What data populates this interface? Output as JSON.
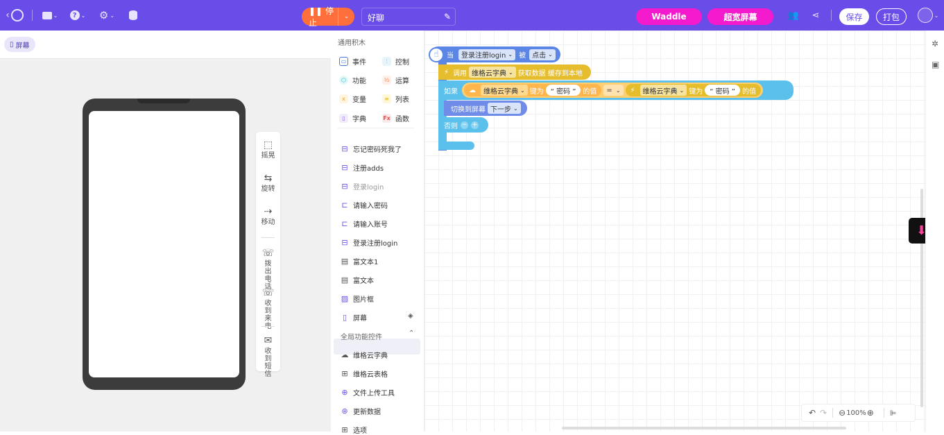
{
  "toolbar": {
    "back": "‹",
    "stop_label": "停止",
    "project_name": "好聊",
    "waddle_label": "Waddle",
    "wide_screen_label": "超宽屏幕",
    "save_label": "保存",
    "pack_label": "打包"
  },
  "screen_tab": {
    "label": "屏幕"
  },
  "device_tools": [
    {
      "label": "摇晃",
      "icon": "phone-shake-icon",
      "glyph": "⬚"
    },
    {
      "label": "旋转",
      "icon": "rotate-icon",
      "glyph": "⇆"
    },
    {
      "label": "移动",
      "icon": "move-icon",
      "glyph": "⇢"
    },
    {
      "label": "拨出电话",
      "icon": "phone-out-icon",
      "glyph": "☏"
    },
    {
      "label": "收到来电",
      "icon": "phone-in-icon",
      "glyph": "☏"
    },
    {
      "label": "收到短信",
      "icon": "message-icon",
      "glyph": "✉"
    }
  ],
  "palette": {
    "general_title": "通用积木",
    "categories": [
      {
        "label": "事件",
        "color": "#4a7ae8"
      },
      {
        "label": "控制",
        "color": "#2f9be0"
      },
      {
        "label": "功能",
        "color": "#1bb4c8"
      },
      {
        "label": "运算",
        "color": "#ff7a45"
      },
      {
        "label": "变量",
        "color": "#f0a020"
      },
      {
        "label": "列表",
        "color": "#e8b800"
      },
      {
        "label": "字典",
        "color": "#8a63e8"
      },
      {
        "label": "函数",
        "color": "#f04848"
      }
    ],
    "components": [
      {
        "label": "忘记密码死我了",
        "icon": "button-icon"
      },
      {
        "label": "注册adds",
        "icon": "button-icon"
      },
      {
        "label": "登录login",
        "icon": "button-icon"
      },
      {
        "label": "请输入密码",
        "icon": "input-icon"
      },
      {
        "label": "请输入账号",
        "icon": "input-icon"
      },
      {
        "label": "登录注册login",
        "icon": "button-icon"
      },
      {
        "label": "富文本1",
        "icon": "richtext-icon"
      },
      {
        "label": "富文本",
        "icon": "richtext-icon"
      },
      {
        "label": "图片框",
        "icon": "image-icon"
      },
      {
        "label": "屏幕",
        "icon": "screen-icon"
      }
    ],
    "global_title": "全局功能控件",
    "global_items": [
      {
        "label": "维格云字典",
        "icon": "cloud-icon"
      },
      {
        "label": "维格云表格",
        "icon": "table-icon"
      },
      {
        "label": "文件上传工具",
        "icon": "upload-icon"
      },
      {
        "label": "更新数据",
        "icon": "refresh-icon"
      },
      {
        "label": "选项",
        "icon": "option-icon"
      }
    ]
  },
  "blocks": {
    "event_when": "当",
    "event_target": "登录注册login",
    "event_by": "被",
    "event_action": "点击",
    "call_label": "调用",
    "call_target": "维格云字典",
    "call_method": "获取数据 缓存到本地",
    "if_label": "如果",
    "cond_left_source": "维格云字典",
    "cond_key_label": "键为",
    "cond_key_value": "“ 密码 ”",
    "cond_value_label": "的值",
    "cond_op": "=",
    "cond_right_source": "维格云字典",
    "cond_right_key_label": "键为",
    "cond_right_key_value": "“ 密码 ”",
    "cond_right_value_label": "的值",
    "switch_label": "切换到屏幕",
    "switch_target": "下一步",
    "else_label": "否则"
  },
  "zoom": {
    "level": "100%"
  },
  "colors": {
    "accent": "#6a4de8",
    "stop": "#ff6f3c",
    "pink": "#f31bcd",
    "event_block": "#5b86e5",
    "call_block": "#e6bd2c",
    "control_block": "#5bc0eb"
  }
}
